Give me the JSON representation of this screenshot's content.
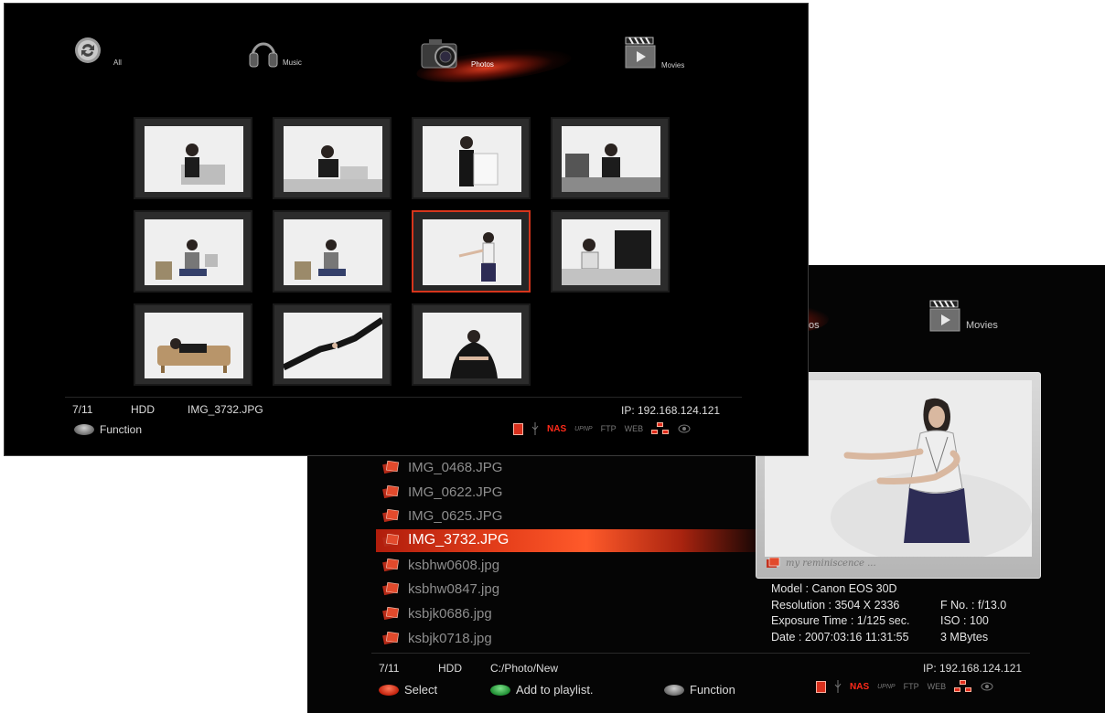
{
  "front": {
    "categories": [
      {
        "label": "All",
        "icon": "refresh-icon"
      },
      {
        "label": "Music",
        "icon": "headphones-icon"
      },
      {
        "label": "Photos",
        "icon": "camera-icon",
        "active": true
      },
      {
        "label": "Movies",
        "icon": "clapper-icon"
      }
    ],
    "thumbnails_count": 11,
    "selected_index": 7,
    "status": {
      "position": "7/11",
      "source": "HDD",
      "filename": "IMG_3732.JPG",
      "ip": "IP: 192.168.124.121"
    },
    "hints": {
      "function_key": "8",
      "function_label": "Function"
    },
    "status_icons": {
      "nas": "NAS",
      "upnp": "UPNP",
      "ftp": "FTP",
      "web": "WEB"
    }
  },
  "back": {
    "partial_category_tail": "os",
    "movies_label": "Movies",
    "files": [
      {
        "name": "IMG_0468.JPG"
      },
      {
        "name": "IMG_0622.JPG"
      },
      {
        "name": "IMG_0625.JPG"
      },
      {
        "name": "IMG_3732.JPG",
        "selected": true
      },
      {
        "name": "ksbhw0608.jpg"
      },
      {
        "name": "ksbhw0847.jpg"
      },
      {
        "name": "ksbjk0686.jpg"
      },
      {
        "name": "ksbjk0718.jpg"
      }
    ],
    "preview_caption": "my reminiscence ...",
    "meta": {
      "model": "Model : Canon EOS 30D",
      "resolution": "Resolution : 3504 X 2336",
      "fno": "F No. : f/13.0",
      "exposure": "Exposure Time : 1/125 sec.",
      "iso": "ISO : 100",
      "date": "Date : 2007:03:16 11:31:55",
      "size": "3 MBytes"
    },
    "status": {
      "position": "7/11",
      "source": "HDD",
      "path": "C:/Photo/New",
      "ip": "IP: 192.168.124.121"
    },
    "hints": {
      "select_key": "1",
      "select_label": "Select",
      "playlist_key": "2",
      "playlist_label": "Add to playlist.",
      "function_key": "8",
      "function_label": "Function"
    },
    "status_icons": {
      "nas": "NAS",
      "upnp": "UPNP",
      "ftp": "FTP",
      "web": "WEB"
    }
  },
  "colors": {
    "accent": "#e8411c",
    "selection_border": "#d6351c",
    "background": "#000000"
  }
}
